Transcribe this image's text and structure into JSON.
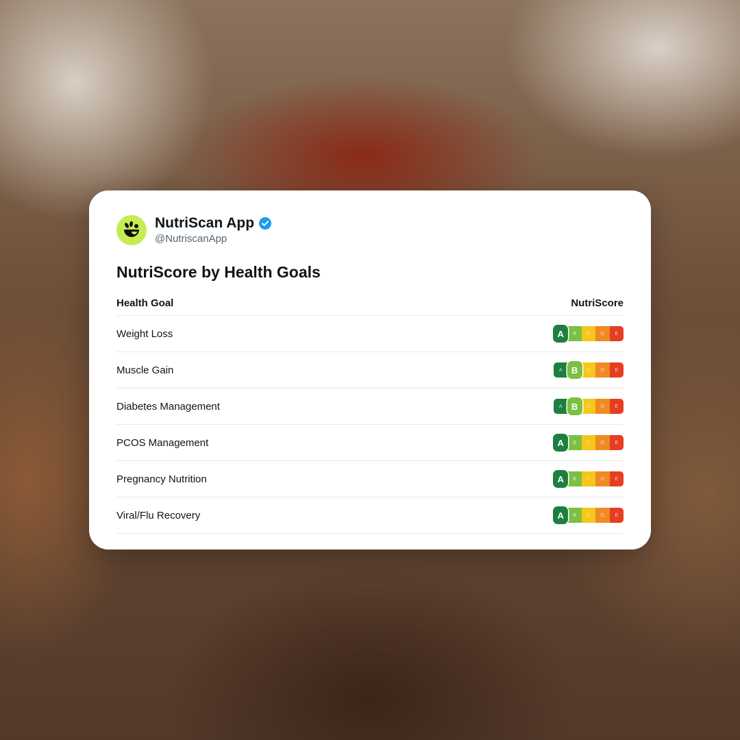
{
  "app": {
    "name": "NutriScan App",
    "handle": "@NutriscanApp",
    "avatar_icon": "leaf-face-icon",
    "verified_icon": "verified-badge-icon"
  },
  "title": "NutriScore by Health Goals",
  "table": {
    "headers": {
      "goal": "Health Goal",
      "score": "NutriScore"
    },
    "rows": [
      {
        "goal": "Weight Loss",
        "score": "A"
      },
      {
        "goal": "Muscle Gain",
        "score": "B"
      },
      {
        "goal": "Diabetes Management",
        "score": "B"
      },
      {
        "goal": "PCOS Management",
        "score": "A"
      },
      {
        "goal": "Pregnancy Nutrition",
        "score": "A"
      },
      {
        "goal": "Viral/Flu Recovery",
        "score": "A"
      }
    ]
  },
  "scale": {
    "letters": [
      "A",
      "B",
      "C",
      "D",
      "E"
    ],
    "colors": [
      "#1e7f41",
      "#7bc043",
      "#f6c61a",
      "#f08a24",
      "#e63e21"
    ]
  },
  "colors": {
    "avatar_bg": "#c6ec53",
    "verified": "#1d9bf0"
  }
}
